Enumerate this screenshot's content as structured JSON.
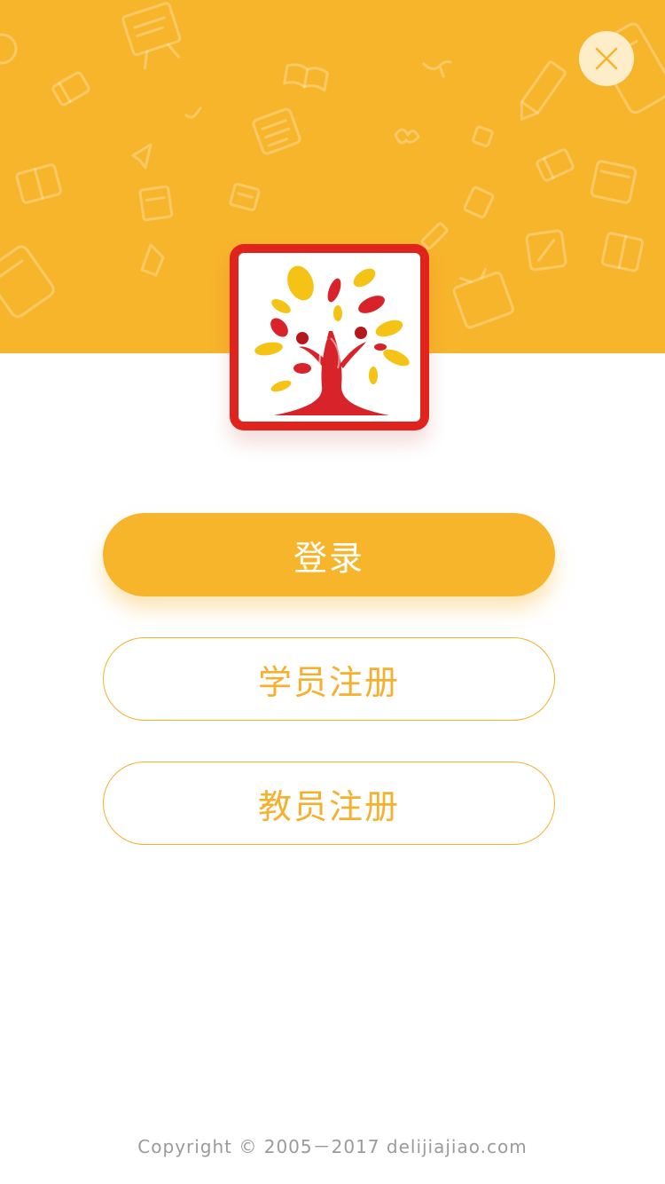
{
  "header": {
    "background_color": "#f7b52c",
    "close_icon": "close-icon"
  },
  "logo": {
    "icon": "tree-people-logo-icon",
    "frame_color": "#e0231c"
  },
  "actions": {
    "login_label": "登录",
    "student_register_label": "学员注册",
    "teacher_register_label": "教员注册"
  },
  "colors": {
    "accent": "#f7b52c",
    "footer_text": "#9a9a9a"
  },
  "footer": {
    "copyright": "Copyright © 2005－2017 delijiajiao.com"
  }
}
